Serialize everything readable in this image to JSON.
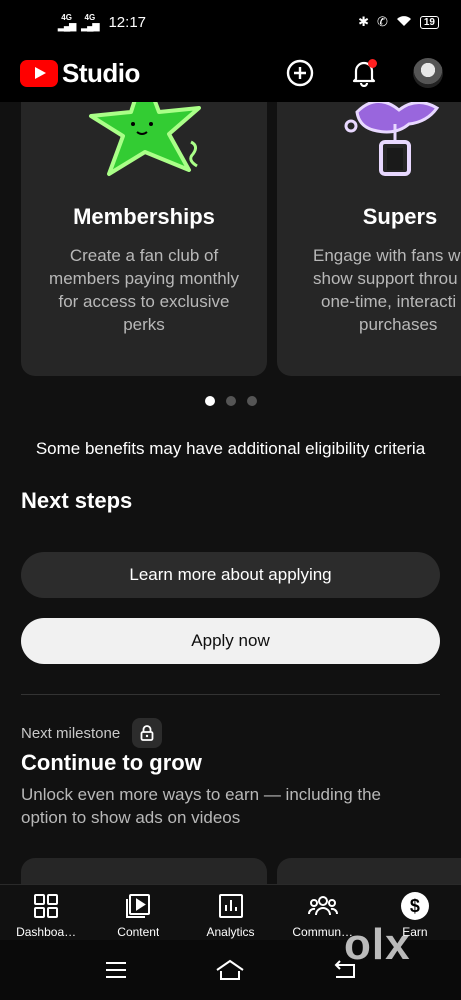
{
  "status_bar": {
    "network_1": "4G",
    "network_2": "4G",
    "time": "12:17",
    "battery": "19"
  },
  "app_bar": {
    "logo_text": "Studio",
    "create_icon": "plus-circle-icon",
    "notification_icon": "bell-icon",
    "avatar_icon": "avatar"
  },
  "benefit_cards": [
    {
      "title": "Memberships",
      "description": "Create a fan club of members paying monthly for access to exclusive perks"
    },
    {
      "title": "Supers",
      "description_lines": [
        "Engage with fans w",
        "show support throu",
        "one-time, interacti",
        "purchases"
      ]
    }
  ],
  "carousel": {
    "count": 3,
    "active_index": 0
  },
  "eligibility_note": "Some benefits may have additional eligibility criteria",
  "next_steps": {
    "title": "Next steps",
    "learn_more_label": "Learn more about applying",
    "apply_label": "Apply now"
  },
  "milestone": {
    "label": "Next milestone",
    "lock_icon": "lock-icon",
    "title": "Continue to grow",
    "description": "Unlock even more ways to earn — including the option to show ads on videos"
  },
  "bottom_nav": [
    {
      "label": "Dashboa…",
      "icon": "dashboard-icon"
    },
    {
      "label": "Content",
      "icon": "content-icon"
    },
    {
      "label": "Analytics",
      "icon": "analytics-icon"
    },
    {
      "label": "Commun…",
      "icon": "community-icon"
    },
    {
      "label": "Earn",
      "icon": "dollar-icon"
    }
  ],
  "system_nav": [
    "menu-icon",
    "home-icon",
    "back-icon"
  ],
  "watermark": "olx",
  "colors": {
    "brand_red": "#ff0000",
    "background": "#111111",
    "card": "#262626",
    "notification_dot": "#ff2020",
    "membership_green": "#33cc33",
    "supers_purple": "#9966dd"
  }
}
